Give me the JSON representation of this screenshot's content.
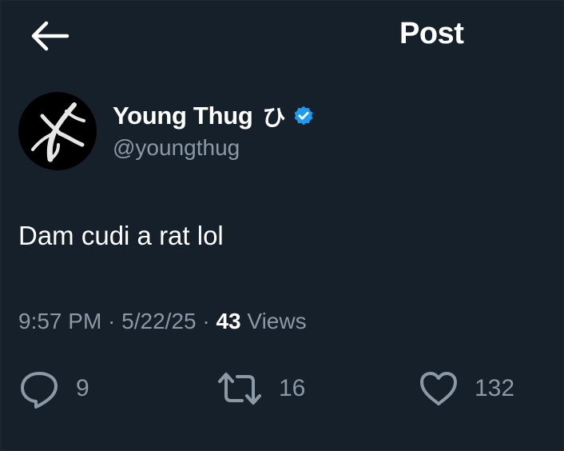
{
  "header": {
    "title": "Post",
    "back_icon": "arrow-left-icon"
  },
  "author": {
    "display_name": "Young Thug",
    "name_emoji": "ひ",
    "handle": "@youngthug",
    "verified": true,
    "verified_color": "#1d9bf0"
  },
  "post": {
    "text": "Dam cudi a rat lol"
  },
  "meta": {
    "time": "9:57 PM",
    "separator": " · ",
    "date": "5/22/25",
    "views_count": "43",
    "views_label": " Views"
  },
  "actions": {
    "replies": "9",
    "reposts": "16",
    "likes": "132"
  },
  "colors": {
    "background": "#15202b",
    "muted_text": "#8b98a5",
    "accent": "#1d9bf0"
  }
}
